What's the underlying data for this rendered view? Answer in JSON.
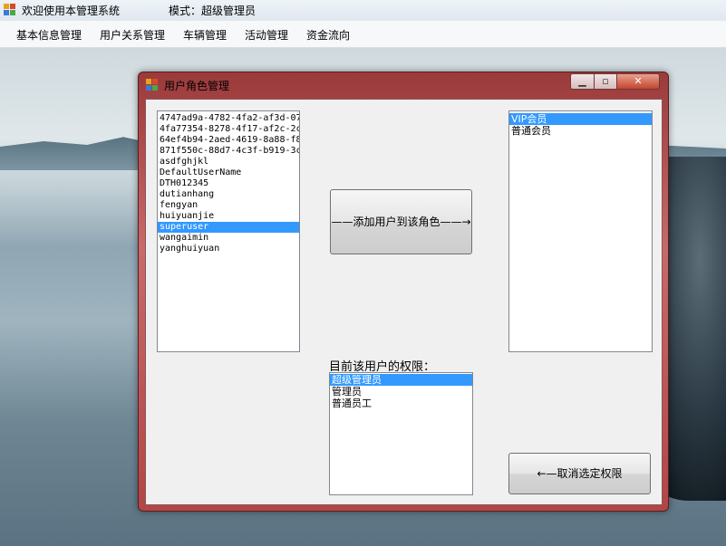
{
  "window": {
    "title": "欢迎使用本管理系统",
    "mode_text": "模式：超级管理员"
  },
  "menu": [
    {
      "label": "基本信息管理"
    },
    {
      "label": "用户关系管理"
    },
    {
      "label": "车辆管理"
    },
    {
      "label": "活动管理"
    },
    {
      "label": "资金流向"
    }
  ],
  "dialog": {
    "title": "用户角色管理",
    "users": [
      "4747ad9a-4782-4fa2-af3d-07",
      "4fa77354-8278-4f17-af2c-2c",
      "64ef4b94-2aed-4619-8a88-f8",
      "871f550c-88d7-4c3f-b919-3c",
      "asdfghjkl",
      "DefaultUserName",
      "DTH012345",
      "dutianhang",
      "fengyan",
      "huiyuanjie",
      "superuser",
      "wangaimin",
      "yanghuiyuan"
    ],
    "selected_user": "superuser",
    "roles": [
      "VIP会员",
      "普通会员"
    ],
    "selected_role": "VIP会员",
    "add_button_label": "——添加用户到该角色——→",
    "permissions_label": "目前该用户的权限：",
    "permissions": [
      "超级管理员",
      "管理员",
      "普通员工"
    ],
    "selected_permission": "超级管理员",
    "cancel_button_label": "←—取消选定权限"
  }
}
